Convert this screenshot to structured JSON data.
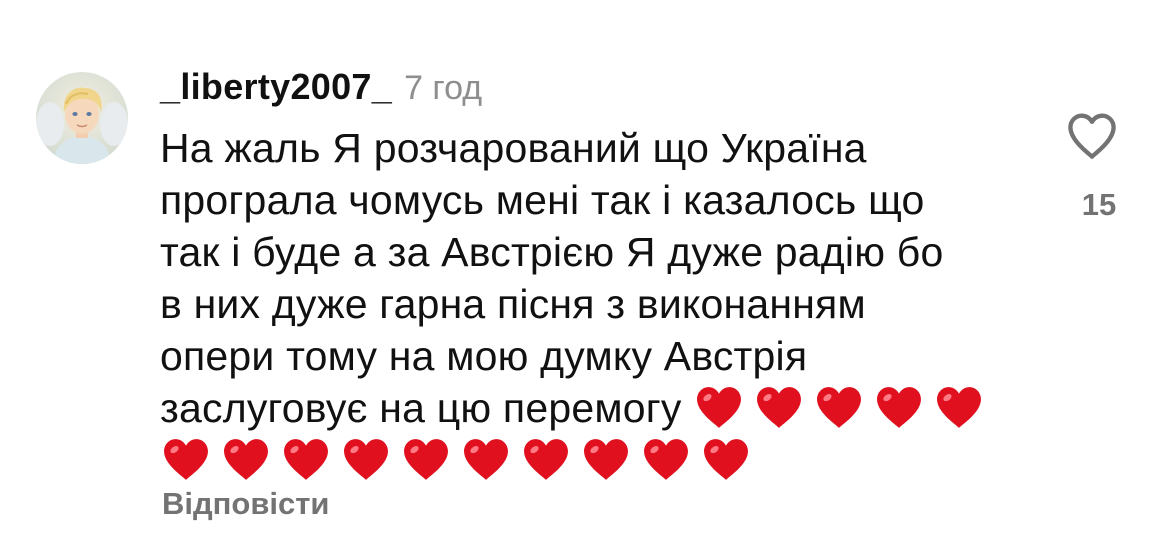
{
  "comment": {
    "username": "_liberty2007_",
    "time_ago": "7 год",
    "text": "На жаль Я розчарований що Україна\nпрограла чомусь мені так і казалось що\nтак і буде а за Австрією Я дуже радію бо\nв них дуже гарна пісня з виконанням\nопери тому на мою думку Австрія\nзаслуговує на цю перемогу ",
    "heart_emoji_count": 15,
    "emoji_icon": "red-heart-emoji",
    "reply_label": "Відповісти",
    "like_icon": "heart-outline-icon",
    "like_count": "15"
  },
  "colors": {
    "text_primary": "#111111",
    "text_secondary": "#737373",
    "heart_red": "#e0101e"
  }
}
